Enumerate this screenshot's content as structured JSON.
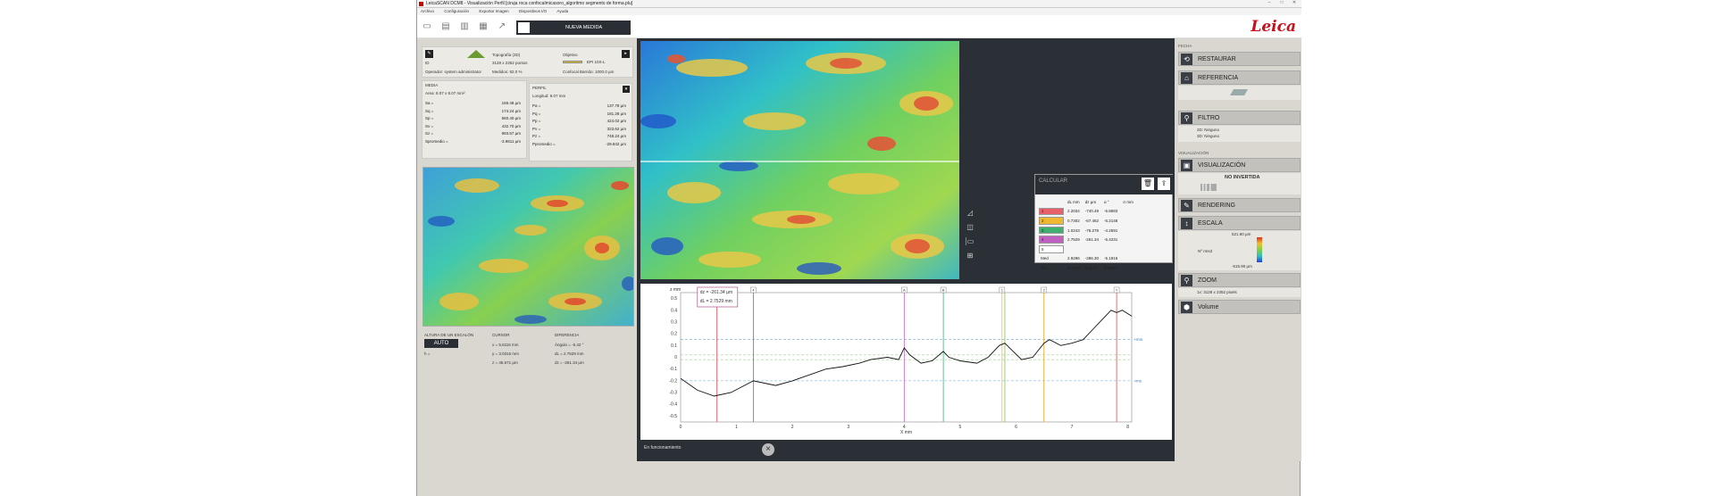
{
  "window": {
    "title": "LeicaSCAN DCM8 - Visualización Perfil [ciruja roca confocalmicasoro_algoritmo segmento de forma.plu]",
    "min": "–",
    "max": "□",
    "close": "✕"
  },
  "menu": [
    "Archivo",
    "Configuración",
    "Exportar Imagen",
    "Dispositivos I/O",
    "Ayuda"
  ],
  "toolbar": {
    "nueva": "NUEVA MEDIDA",
    "logo": "Leica"
  },
  "info": {
    "tipo": "Topografía (3D)",
    "puntos": "3128 x 2352 puntos",
    "id_lbl": "ID",
    "operador": "Operador: system administrator",
    "medidos": "Medidos: 82.0 %",
    "objetivo": "Objetivo",
    "obj_name": "EPI 10X-L",
    "confocal": "Confocal Barrido: 1000.0 µm"
  },
  "media": {
    "title": "MEDIA",
    "area": "Area: 8.07 x 8.07 mm²",
    "rows": [
      [
        "Sa =",
        "159.48 µm"
      ],
      [
        "Sq =",
        "174.24 µm"
      ],
      [
        "Sp =",
        "560.40 µm"
      ],
      [
        "Sv =",
        "432.70 µm"
      ],
      [
        "Sz =",
        "993.57 µm"
      ],
      [
        "Spromedio =",
        "-3.9811 µm"
      ]
    ]
  },
  "perfil": {
    "title": "PERFIL",
    "long": "Longitud: 8.07 mm",
    "rows": [
      [
        "Pa =",
        "137.78 µm"
      ],
      [
        "Pq =",
        "181.28 µm"
      ],
      [
        "Pp =",
        "424.02 µm"
      ],
      [
        "Pv =",
        "323.62 µm"
      ],
      [
        "Pz =",
        "748.24 µm"
      ],
      [
        "Ppromedio =",
        "-29.842 µm"
      ]
    ]
  },
  "step": {
    "title": "ALTURA DE UN ESCALÓN",
    "auto": "AUTO",
    "h": "h ="
  },
  "cursor": {
    "title": "CURSOR",
    "x": "x = 5.6115 mm",
    "y": "y = 3.0315 mm",
    "z": "z = 45.671 µm"
  },
  "diff": {
    "title": "DIFERENCIA",
    "ang": "Ángulo = -5.42 °",
    "dl": "dL = 2.7529 mm",
    "dz": "dz = -261.34 µm"
  },
  "calc": {
    "title": "CALCULAR",
    "headers": [
      "dL mm",
      "dz µm",
      "α °",
      "σ mm"
    ],
    "rows": [
      {
        "n": "1",
        "c": "#e8606a",
        "v": [
          "2.2034",
          "-740.49",
          "-5.8693",
          ""
        ]
      },
      {
        "n": "2",
        "c": "#f0b830",
        "v": [
          "0.7302",
          "-67.462",
          "-5.2148",
          ""
        ]
      },
      {
        "n": "3",
        "c": "#40b070",
        "v": [
          "1.0243",
          "-76.278",
          "-4.2591",
          ""
        ]
      },
      {
        "n": "4",
        "c": "#c060c0",
        "v": [
          "2.7529",
          "-261.34",
          "-5.4231",
          ""
        ]
      },
      {
        "n": "5",
        "c": "#ffffff",
        "v": [
          "",
          "",
          "",
          ""
        ]
      }
    ],
    "med": [
      "Med",
      "2.9296",
      "-286.30",
      "-5.1916"
    ],
    "std": [
      "Std",
      "2.3848",
      "275.37",
      "0.5860"
    ]
  },
  "graph": {
    "yunit": "z mm",
    "xunit": "X mm",
    "yticks": [
      "0.5",
      "0.4",
      "0.3",
      "0.2",
      "0.1",
      "0",
      "-0.1",
      "-0.2",
      "-0.3",
      "-0.4",
      "-0.5"
    ],
    "xticks": [
      "0",
      "1",
      "2",
      "3",
      "4",
      "5",
      "6",
      "7",
      "8"
    ],
    "tip1": "dz = -261.34 µm",
    "tip2": "dL = 2.7529 mm",
    "rms_top": "+rms",
    "rms_bot": "-rms",
    "markers": [
      "4",
      "A",
      "B",
      "1",
      "2",
      "Y"
    ]
  },
  "status": "En funcionamiento",
  "right": {
    "fecha": "FECHA",
    "restaurar": "RESTAURAR",
    "referencia": "REFERENCIA",
    "filtro": "FILTRO",
    "f2d": "2D: Ninguno",
    "f3d": "3D: Ninguno",
    "visualizacion_sec": "VISUALIZACIÓN",
    "visualizacion": "VISUALIZACIÓN",
    "no_invertida": "NO INVERTIDA",
    "rendering": "RENDERING",
    "escala": "ESCALA",
    "scale_max": "521.80 µm",
    "scale_min": "-515.90 µm",
    "scale_lbl": "Nº rms3",
    "zoom": "ZOOM",
    "zoom_val": "1x: 3128 x 2352 pixels",
    "volume": "Volume"
  }
}
